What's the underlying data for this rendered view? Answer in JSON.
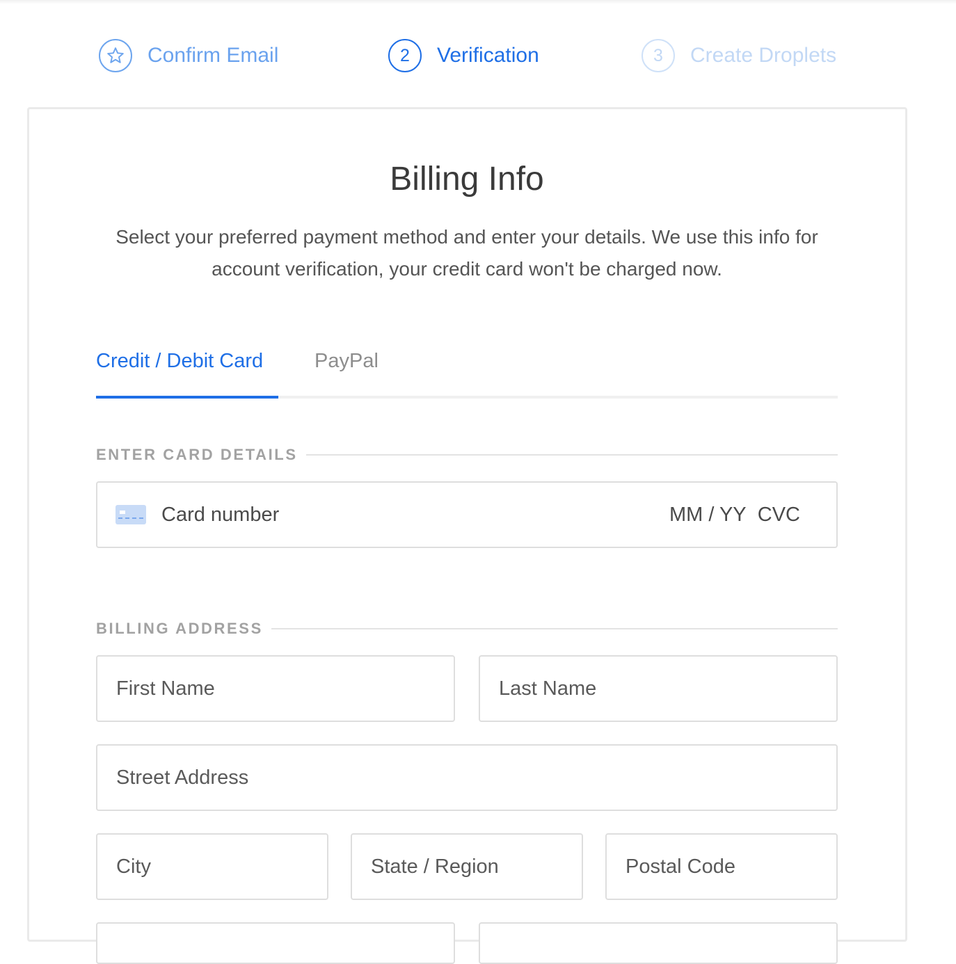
{
  "steps": [
    {
      "marker": "☆",
      "label": "Confirm Email",
      "state": "done"
    },
    {
      "marker": "2",
      "label": "Verification",
      "state": "active"
    },
    {
      "marker": "3",
      "label": "Create Droplets",
      "state": "todo"
    }
  ],
  "billing": {
    "title": "Billing Info",
    "subtitle": "Select your preferred payment method and enter your details. We use this info for account verification, your credit card won't be charged now."
  },
  "tabs": [
    {
      "label": "Credit / Debit Card",
      "active": true
    },
    {
      "label": "PayPal",
      "active": false
    }
  ],
  "card_section": {
    "header": "ENTER CARD DETAILS",
    "card_number_placeholder": "Card number",
    "expiry_placeholder": "MM / YY",
    "cvc_placeholder": "CVC",
    "icon": "credit-card-icon"
  },
  "address_section": {
    "header": "BILLING ADDRESS",
    "first_name": "First Name",
    "last_name": "Last Name",
    "street": "Street Address",
    "city": "City",
    "state": "State / Region",
    "postal": "Postal Code"
  },
  "colors": {
    "accent": "#1f6fe6",
    "step_done": "#6aa2ee",
    "step_todo": "#c2d8f5",
    "border": "#dedede"
  }
}
